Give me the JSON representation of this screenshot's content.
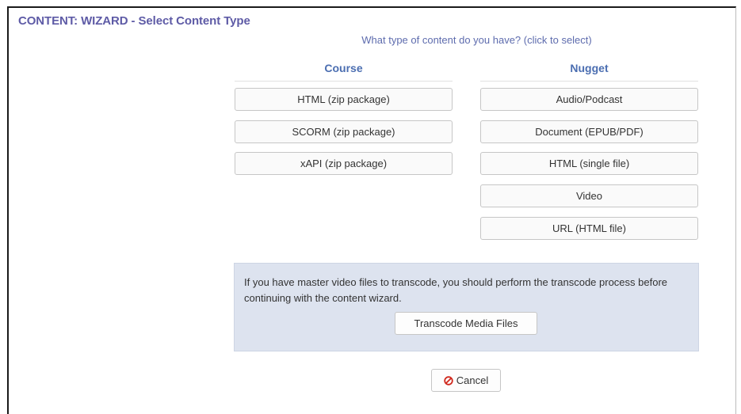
{
  "header": {
    "title": "CONTENT: WIZARD - Select Content Type"
  },
  "instruction": "What type of content do you have? (click to select)",
  "course": {
    "heading": "Course",
    "options": [
      "HTML (zip package)",
      "SCORM (zip package)",
      "xAPI (zip package)"
    ]
  },
  "nugget": {
    "heading": "Nugget",
    "options": [
      "Audio/Podcast",
      "Document (EPUB/PDF)",
      "HTML (single file)",
      "Video",
      "URL (HTML file)"
    ]
  },
  "transcode_panel": {
    "message": "If you have master video files to transcode, you should perform the transcode process before continuing with the content wizard.",
    "button_label": "Transcode Media Files"
  },
  "footer": {
    "cancel_label": "Cancel",
    "cancel_icon": "cancel-circle-icon"
  },
  "colors": {
    "title": "#5e5ba6",
    "heading": "#4b6eb1",
    "panel_bg": "#dde3ef",
    "cancel_icon": "#d0281d"
  }
}
